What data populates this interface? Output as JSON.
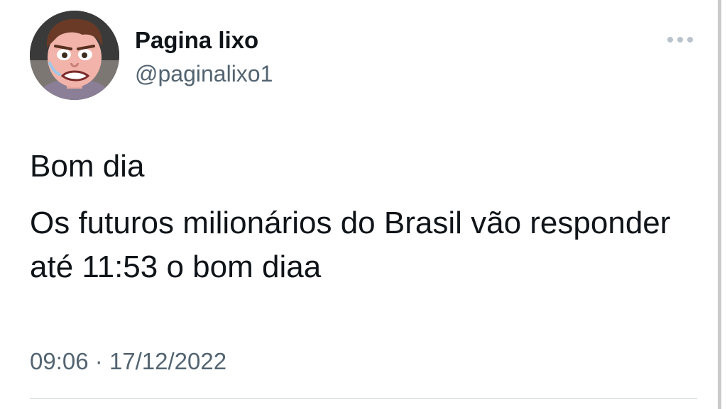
{
  "author": {
    "display_name": "Pagina lixo",
    "handle": "@paginalixo1",
    "avatar_icon": "cartoon-face-avatar"
  },
  "more_icon": "more-horizontal-icon",
  "tweet": {
    "lines": [
      "Bom dia",
      "Os futuros milionários do Brasil vão responder até 11:53 o bom diaa"
    ]
  },
  "meta": {
    "time": "09:06",
    "separator": "·",
    "date": "17/12/2022"
  },
  "colors": {
    "text": "#0f1419",
    "secondary": "#536471",
    "divider": "#cfd9de"
  }
}
